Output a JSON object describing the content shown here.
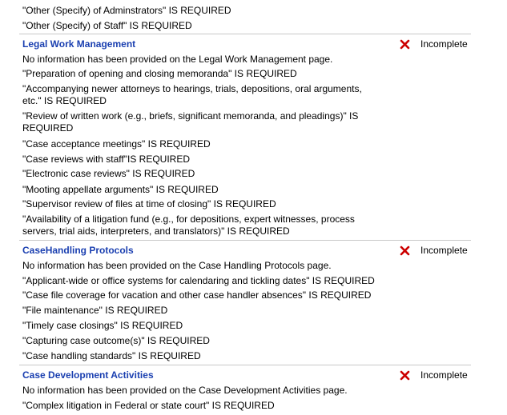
{
  "leading_items": [
    "\"Other (Specify) of Adminstrators\" IS REQUIRED",
    "\"Other (Specify) of Staff\" IS REQUIRED"
  ],
  "status_icon": "x-mark-icon",
  "status_color": "#cc0000",
  "title_color": "#1a3fb0",
  "sections": [
    {
      "title": "Legal Work Management",
      "status": "Incomplete",
      "items": [
        "No information has been provided on the Legal Work Management page.",
        "\"Preparation of opening and closing memoranda\" IS REQUIRED",
        "\"Accompanying newer attorneys to hearings, trials, depositions, oral arguments, etc.\" IS REQUIRED",
        "\"Review of written work (e.g., briefs, significant memoranda, and pleadings)\" IS REQUIRED",
        "\"Case acceptance meetings\" IS REQUIRED",
        "\"Case reviews with staff\"IS REQUIRED",
        "\"Electronic case reviews\" IS REQUIRED",
        "\"Mooting appellate arguments\" IS REQUIRED",
        "\"Supervisor review of files at time of closing\" IS REQUIRED",
        "\"Availability of a litigation fund (e.g., for depositions, expert witnesses, process servers, trial aids, interpreters, and translators)\" IS REQUIRED"
      ]
    },
    {
      "title": "CaseHandling Protocols",
      "status": "Incomplete",
      "items": [
        "No information has been provided on the Case Handling Protocols page.",
        "\"Applicant-wide or office systems for calendaring and tickling dates\" IS REQUIRED",
        "\"Case file coverage for vacation and other case handler absences\" IS REQUIRED",
        "\"File maintenance\" IS REQUIRED",
        "\"Timely case closings\" IS REQUIRED",
        "\"Capturing case outcome(s)\" IS REQUIRED",
        "\"Case handling standards\" IS REQUIRED"
      ]
    },
    {
      "title": "Case Development Activities",
      "status": "Incomplete",
      "items": [
        "No information has been provided on the Case Development Activities page.",
        "\"Complex litigation in Federal or state court\" IS REQUIRED"
      ]
    }
  ]
}
